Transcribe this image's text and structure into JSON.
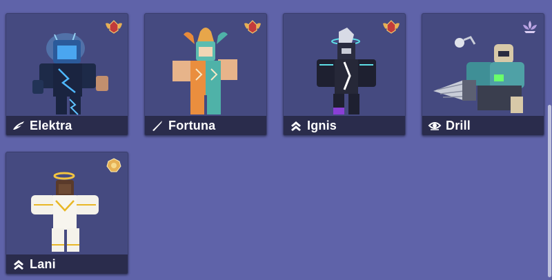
{
  "grid": {
    "cards": [
      {
        "name": "Elektra",
        "class_icon": "wing-icon",
        "rank_badge": "winged-rank-icon",
        "body_color": "#1c2c4d",
        "accent": "#34a7ff"
      },
      {
        "name": "Fortuna",
        "class_icon": "sword-icon",
        "rank_badge": "winged-rank-icon",
        "body_color": "#ea8e3e",
        "accent": "#4fb2a8"
      },
      {
        "name": "Ignis",
        "class_icon": "double-chevron-icon",
        "rank_badge": "winged-rank-icon",
        "body_color": "#1e2030",
        "accent": "#5ee0e8"
      },
      {
        "name": "Drill",
        "class_icon": "eye-icon",
        "rank_badge": "lotus-rank-icon",
        "body_color": "#3f8f96",
        "accent": "#c9cdd8"
      },
      {
        "name": "Lani",
        "class_icon": "double-chevron-icon",
        "rank_badge": "gold-crest-icon",
        "body_color": "#f4f2ea",
        "accent": "#e8b726"
      }
    ]
  },
  "colors": {
    "background": "#5f63a9",
    "card": "#454a80",
    "namebar": "#2a2c4c"
  }
}
